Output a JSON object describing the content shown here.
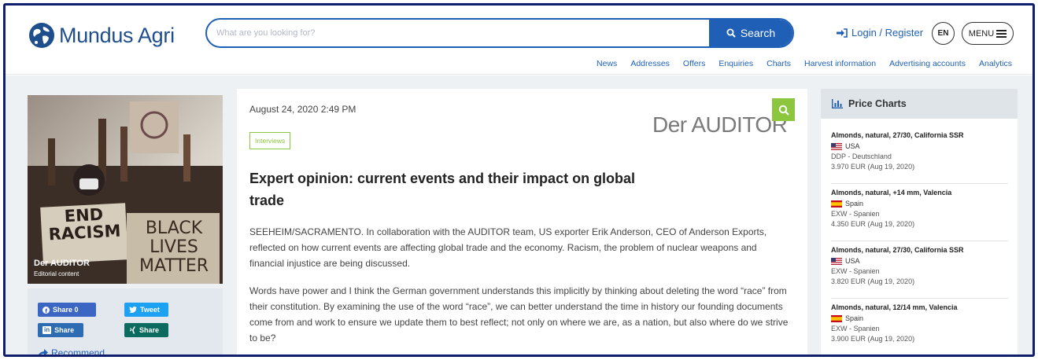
{
  "colors": {
    "brand_blue": "#1f5fb5",
    "frame_navy": "#0f1f6e",
    "green_accent": "#8cc63f",
    "page_bg": "#eef1f4"
  },
  "header": {
    "logo_text": "Mundus Agri",
    "logo_icon": "globe-icon",
    "search_placeholder": "What are you looking for?",
    "search_button_label": "Search",
    "login_label": "Login / Register",
    "language": "EN",
    "menu_label": "MENU"
  },
  "nav": {
    "items": [
      "News",
      "Addresses",
      "Offers",
      "Enquiries",
      "Charts",
      "Harvest information",
      "Advertising accounts",
      "Analytics"
    ]
  },
  "hero": {
    "source": "Der AUDITOR",
    "note": "Editorial content",
    "sign_text_1": "END RACISM",
    "sign_text_2": "BLACK LIVES MATTER"
  },
  "share": {
    "facebook": "Share 0",
    "twitter": "Tweet",
    "linkedin": "Share",
    "xing": "Share",
    "recommend": "Recommend"
  },
  "article": {
    "date": "August 24, 2020 2:49 PM",
    "publisher": "Der AUDITOR",
    "tag": "Interviews",
    "headline": "Expert opinion: current events and their impact on global trade",
    "paragraphs": [
      "SEEHEIM/SACRAMENTO. In collaboration with the AUDITOR team, US exporter Erik Anderson, CEO of Anderson Exports, reflected on how current events are affecting global trade and the economy. Racism, the problem of nuclear weapons and financial injustice are being discussed.",
      "Words have power and I think the German government understands this implicitly by thinking about deleting the word “race” from their constitution. By examining the use of the word “race”, we can better understand the time in history our founding documents come from and work to ensure we update them to best reflect; not only on where we are, as a nation, but also where do we strive to be?"
    ]
  },
  "price_charts": {
    "title": "Price Charts",
    "items": [
      {
        "name": "Almonds, natural, 27/30, California SSR",
        "country": "USA",
        "flag": "usa",
        "terms": "DDP - Deutschland",
        "price": "3.970 EUR (Aug 19, 2020)"
      },
      {
        "name": "Almonds, natural, +14 mm, Valencia",
        "country": "Spain",
        "flag": "spain",
        "terms": "EXW - Spanien",
        "price": "4.350 EUR (Aug 19, 2020)"
      },
      {
        "name": "Almonds, natural, 27/30, California SSR",
        "country": "USA",
        "flag": "usa",
        "terms": "EXW - Spanien",
        "price": "3.820 EUR (Aug 19, 2020)"
      },
      {
        "name": "Almonds, natural, 12/14 mm, Valencia",
        "country": "Spain",
        "flag": "spain",
        "terms": "EXW - Spanien",
        "price": "3.900 EUR (Aug 19, 2020)"
      }
    ]
  }
}
